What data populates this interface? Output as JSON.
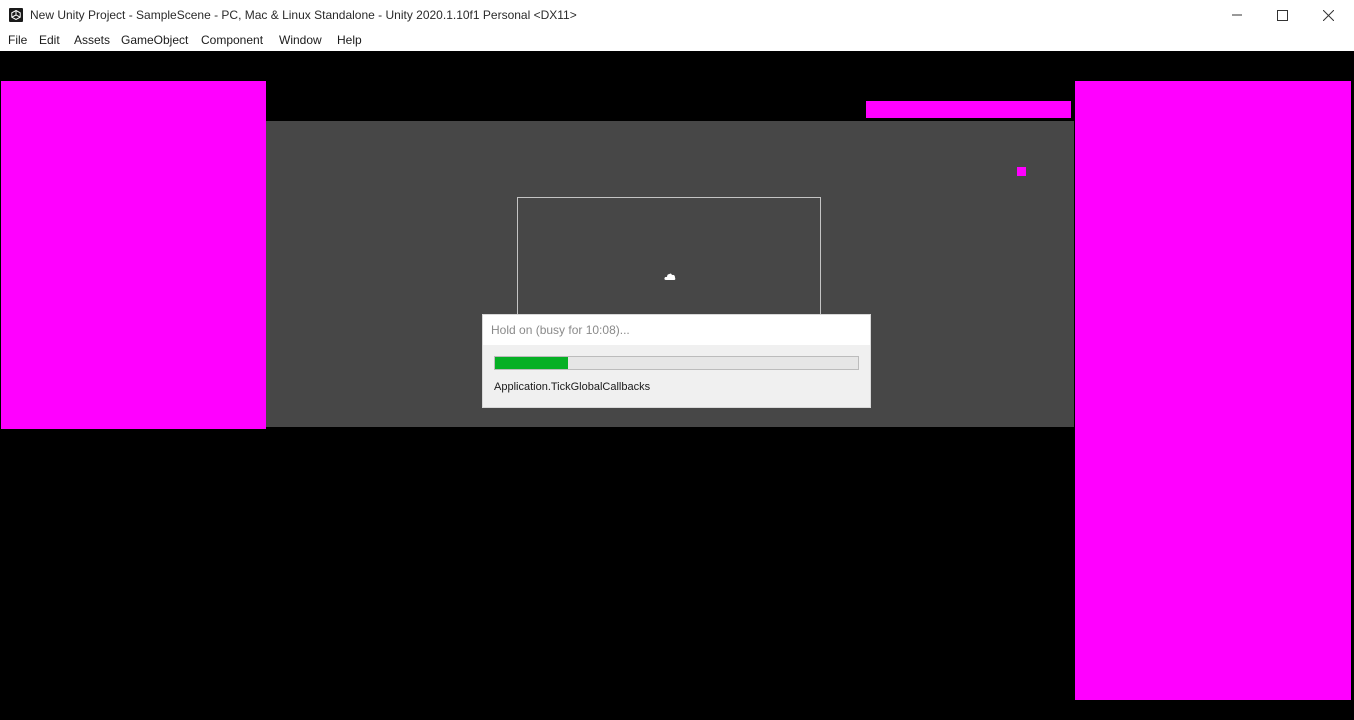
{
  "window": {
    "title": "New Unity Project - SampleScene - PC, Mac & Linux Standalone - Unity 2020.1.10f1 Personal <DX11>",
    "app_icon": "unity-icon",
    "controls": {
      "minimize": "minimize-icon",
      "maximize": "maximize-icon",
      "close": "close-icon"
    }
  },
  "menu": {
    "items": [
      "File",
      "Edit",
      "Assets",
      "GameObject",
      "Component",
      "Window",
      "Help"
    ]
  },
  "scene": {
    "colors": {
      "background": "#000000",
      "magenta": "#ff00ff",
      "gray_area": "#474747"
    },
    "center_icon": "cloud-icon"
  },
  "dialog": {
    "title": "Hold on (busy for 10:08)...",
    "progress_fraction": 0.2,
    "progress_color": "#06b025",
    "status_text": "Application.TickGlobalCallbacks"
  }
}
